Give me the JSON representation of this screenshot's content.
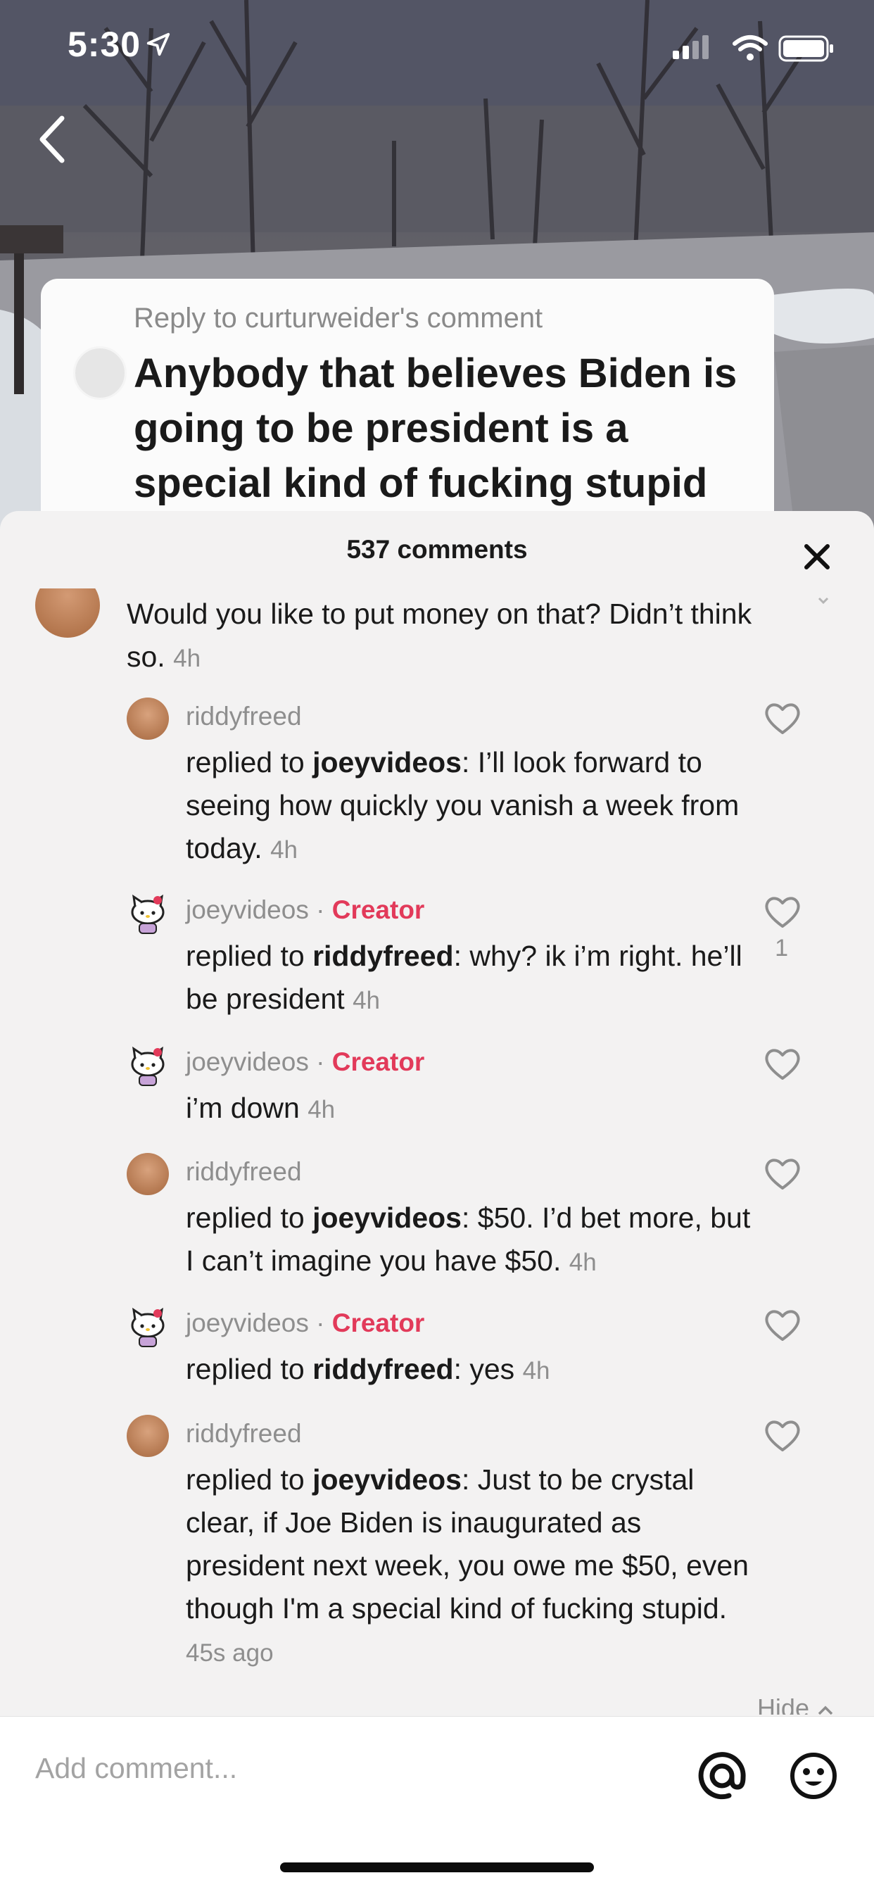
{
  "status_bar": {
    "time": "5:30"
  },
  "reply_card": {
    "label": "Reply to curturweider's comment",
    "text": "Anybody that believes Biden is going to be president is a special kind of fucking stupid"
  },
  "sheet": {
    "title": "537 comments"
  },
  "top_comment": {
    "text": "Would you like to put money on that? Didn’t think so.",
    "time": "4h"
  },
  "comments": [
    {
      "user": "riddyfreed",
      "creator": "",
      "prefix": "replied to ",
      "target": "joeyvideos",
      "text": ": I’ll look forward to seeing how quickly you vanish a week from today.",
      "time": "4h",
      "likes": ""
    },
    {
      "user": "joeyvideos",
      "creator": "Creator",
      "prefix": "replied to ",
      "target": "riddyfreed",
      "text": ": why? ik i’m right. he’ll be president",
      "time": "4h",
      "likes": "1"
    },
    {
      "user": "joeyvideos",
      "creator": "Creator",
      "prefix": "",
      "target": "",
      "text": "i’m down",
      "time": "4h",
      "likes": ""
    },
    {
      "user": "riddyfreed",
      "creator": "",
      "prefix": "replied to ",
      "target": "joeyvideos",
      "text": ": $50. I’d bet more, but I can’t imagine you have $50.",
      "time": "4h",
      "likes": ""
    },
    {
      "user": "joeyvideos",
      "creator": "Creator",
      "prefix": "replied to ",
      "target": "riddyfreed",
      "text": ": yes",
      "time": "4h",
      "likes": ""
    },
    {
      "user": "riddyfreed",
      "creator": "",
      "prefix": "replied to ",
      "target": "joeyvideos",
      "text": ": Just to be crystal clear, if Joe Biden is inaugurated as president next week, you owe me $50, even though I'm a special kind of fucking stupid.",
      "time": "45s ago",
      "likes": ""
    }
  ],
  "separator": " · ",
  "hide_label": "Hide",
  "composer": {
    "placeholder": "Add comment..."
  },
  "icons": [
    "location-arrow-icon",
    "signal-icon",
    "wifi-icon",
    "battery-icon",
    "back-chevron-icon",
    "close-icon",
    "heart-icon",
    "at-sign-icon",
    "emoji-icon",
    "hide-chevron-icon"
  ],
  "colors": {
    "creator": "#e23a5a",
    "muted_text": "#8e8e8e",
    "sheet_bg": "#f3f2f2"
  }
}
